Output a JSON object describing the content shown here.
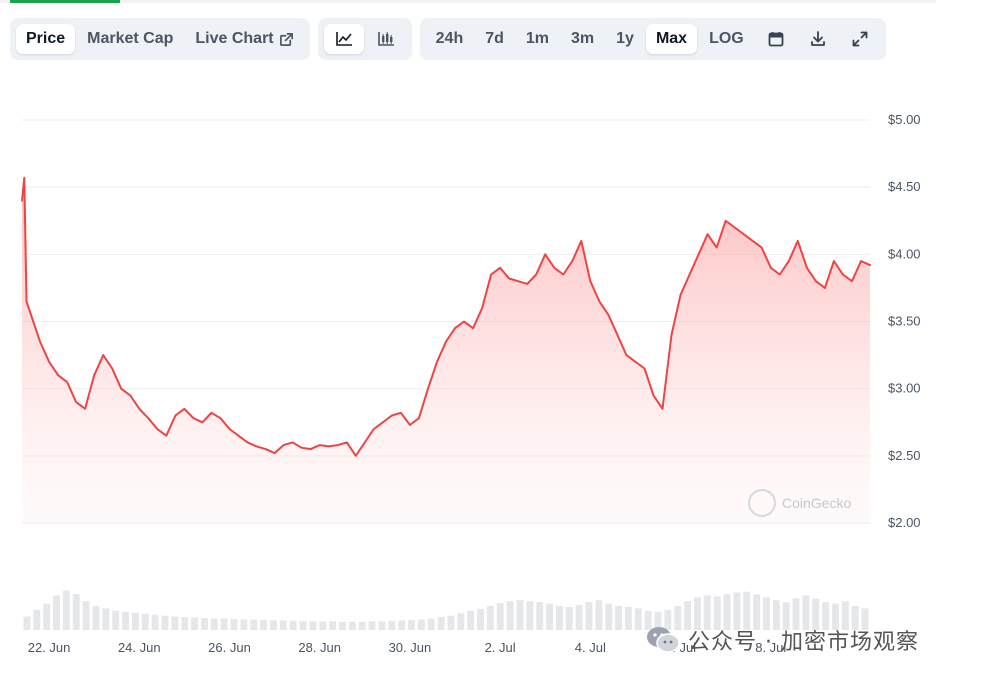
{
  "tabs": {
    "price": "Price",
    "market_cap": "Market Cap",
    "live_chart": "Live Chart",
    "active": "Price"
  },
  "chart_type_buttons": [
    {
      "icon": "line-chart-icon",
      "active": true
    },
    {
      "icon": "candlestick-chart-icon",
      "active": false
    }
  ],
  "ranges": [
    "24h",
    "7d",
    "1m",
    "3m",
    "1y",
    "Max",
    "LOG"
  ],
  "active_range": "Max",
  "tools": [
    "calendar-icon",
    "download-icon",
    "fullscreen-icon"
  ],
  "watermark": "CoinGecko",
  "overlay_caption": "公众号 · 加密市场观察",
  "colors": {
    "line": "#ef4444",
    "fill_top": "#fca5a5",
    "grid": "#eceef1",
    "volume": "#e5e7eb",
    "accent": "#16a34a"
  },
  "chart_data": {
    "type": "area",
    "y_ticks": [
      "$5.00",
      "$4.50",
      "$4.00",
      "$3.50",
      "$3.00",
      "$2.50",
      "$2.00"
    ],
    "y_tick_values": [
      5.0,
      4.5,
      4.0,
      3.5,
      3.0,
      2.5,
      2.0
    ],
    "ylim": [
      2.0,
      5.0
    ],
    "x_ticks": [
      "22. Jun",
      "24. Jun",
      "26. Jun",
      "28. Jun",
      "30. Jun",
      "2. Jul",
      "4. Jul",
      "6. Jul",
      "8. Jul"
    ],
    "x_tick_values": [
      1.0,
      3.0,
      5.0,
      7.0,
      9.0,
      11.0,
      13.0,
      15.0,
      17.0
    ],
    "x_units": "days since 21 Jun",
    "xlim": [
      0.4,
      19.2
    ],
    "grid": true,
    "series": [
      {
        "name": "Price",
        "x": [
          0.4,
          0.45,
          0.5,
          0.6,
          0.8,
          1.0,
          1.2,
          1.4,
          1.6,
          1.8,
          2.0,
          2.2,
          2.4,
          2.6,
          2.8,
          3.0,
          3.2,
          3.4,
          3.6,
          3.8,
          4.0,
          4.2,
          4.4,
          4.6,
          4.8,
          5.0,
          5.2,
          5.4,
          5.6,
          5.8,
          6.0,
          6.2,
          6.4,
          6.6,
          6.8,
          7.0,
          7.2,
          7.4,
          7.6,
          7.8,
          8.0,
          8.2,
          8.4,
          8.6,
          8.8,
          9.0,
          9.2,
          9.4,
          9.6,
          9.8,
          10.0,
          10.2,
          10.4,
          10.6,
          10.8,
          11.0,
          11.2,
          11.4,
          11.6,
          11.8,
          12.0,
          12.2,
          12.4,
          12.6,
          12.8,
          13.0,
          13.2,
          13.4,
          13.6,
          13.8,
          14.0,
          14.2,
          14.4,
          14.6,
          14.8,
          15.0,
          15.2,
          15.4,
          15.6,
          15.8,
          16.0,
          16.2,
          16.4,
          16.6,
          16.8,
          17.0,
          17.2,
          17.4,
          17.6,
          17.8,
          18.0,
          18.2,
          18.4,
          18.6,
          18.8,
          19.0,
          19.2
        ],
        "values": [
          4.4,
          4.57,
          3.65,
          3.55,
          3.35,
          3.2,
          3.1,
          3.05,
          2.9,
          2.85,
          3.1,
          3.25,
          3.15,
          3.0,
          2.95,
          2.85,
          2.78,
          2.7,
          2.65,
          2.8,
          2.85,
          2.78,
          2.75,
          2.82,
          2.78,
          2.7,
          2.65,
          2.6,
          2.57,
          2.55,
          2.52,
          2.58,
          2.6,
          2.56,
          2.55,
          2.58,
          2.57,
          2.58,
          2.6,
          2.5,
          2.6,
          2.7,
          2.75,
          2.8,
          2.82,
          2.73,
          2.78,
          3.0,
          3.2,
          3.35,
          3.45,
          3.5,
          3.45,
          3.6,
          3.85,
          3.9,
          3.82,
          3.8,
          3.78,
          3.85,
          4.0,
          3.9,
          3.85,
          3.95,
          4.1,
          3.8,
          3.65,
          3.55,
          3.4,
          3.25,
          3.2,
          3.15,
          2.95,
          2.85,
          3.4,
          3.7,
          3.85,
          4.0,
          4.15,
          4.05,
          4.25,
          4.2,
          4.15,
          4.1,
          4.05,
          3.9,
          3.85,
          3.95,
          4.1,
          3.9,
          3.8,
          3.75,
          3.95,
          3.85,
          3.8,
          3.95,
          3.92
        ]
      }
    ],
    "volume": {
      "values": [
        0.28,
        0.42,
        0.55,
        0.72,
        0.82,
        0.75,
        0.6,
        0.5,
        0.45,
        0.4,
        0.38,
        0.36,
        0.34,
        0.32,
        0.3,
        0.28,
        0.27,
        0.26,
        0.25,
        0.24,
        0.24,
        0.23,
        0.22,
        0.22,
        0.21,
        0.2,
        0.2,
        0.19,
        0.19,
        0.18,
        0.18,
        0.18,
        0.17,
        0.17,
        0.17,
        0.18,
        0.18,
        0.19,
        0.2,
        0.21,
        0.22,
        0.24,
        0.27,
        0.3,
        0.35,
        0.4,
        0.44,
        0.5,
        0.56,
        0.6,
        0.63,
        0.6,
        0.58,
        0.55,
        0.5,
        0.48,
        0.52,
        0.58,
        0.62,
        0.55,
        0.5,
        0.48,
        0.45,
        0.4,
        0.38,
        0.42,
        0.5,
        0.6,
        0.68,
        0.72,
        0.7,
        0.75,
        0.78,
        0.8,
        0.74,
        0.68,
        0.62,
        0.58,
        0.66,
        0.72,
        0.65,
        0.58,
        0.55,
        0.6,
        0.5,
        0.45
      ]
    }
  }
}
